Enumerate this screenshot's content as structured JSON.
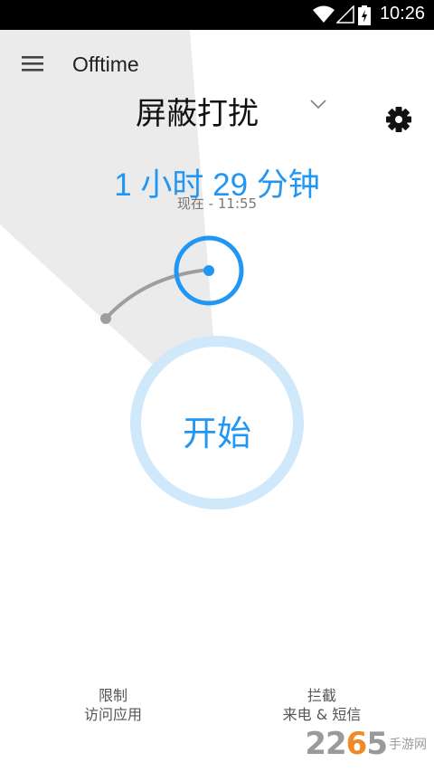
{
  "status_bar": {
    "time": "10:26",
    "icons": [
      "wifi-icon",
      "signal-icon",
      "battery-charging-icon"
    ]
  },
  "header": {
    "menu_icon": "hamburger-menu-icon",
    "title": "Offtime",
    "mode": "屏蔽打扰",
    "mode_icon": "chevron-down-icon",
    "settings_icon": "gear-icon"
  },
  "timer": {
    "duration": "1 小时 29 分钟",
    "now_label": "现在 - 11:55"
  },
  "start_button": {
    "label": "开始"
  },
  "bottom_actions": {
    "left": {
      "line1": "限制",
      "line2": "访问应用"
    },
    "right": {
      "line1": "拦截",
      "line2": "来电 & 短信"
    }
  },
  "watermark": {
    "number_part1": "22",
    "number_part2": "6",
    "number_part3": "5",
    "text": "手游网"
  },
  "colors": {
    "accent": "#2196f3",
    "accent_light": "#cfe9fb",
    "wedge": "#ebebeb",
    "arc": "#9e9e9e"
  }
}
